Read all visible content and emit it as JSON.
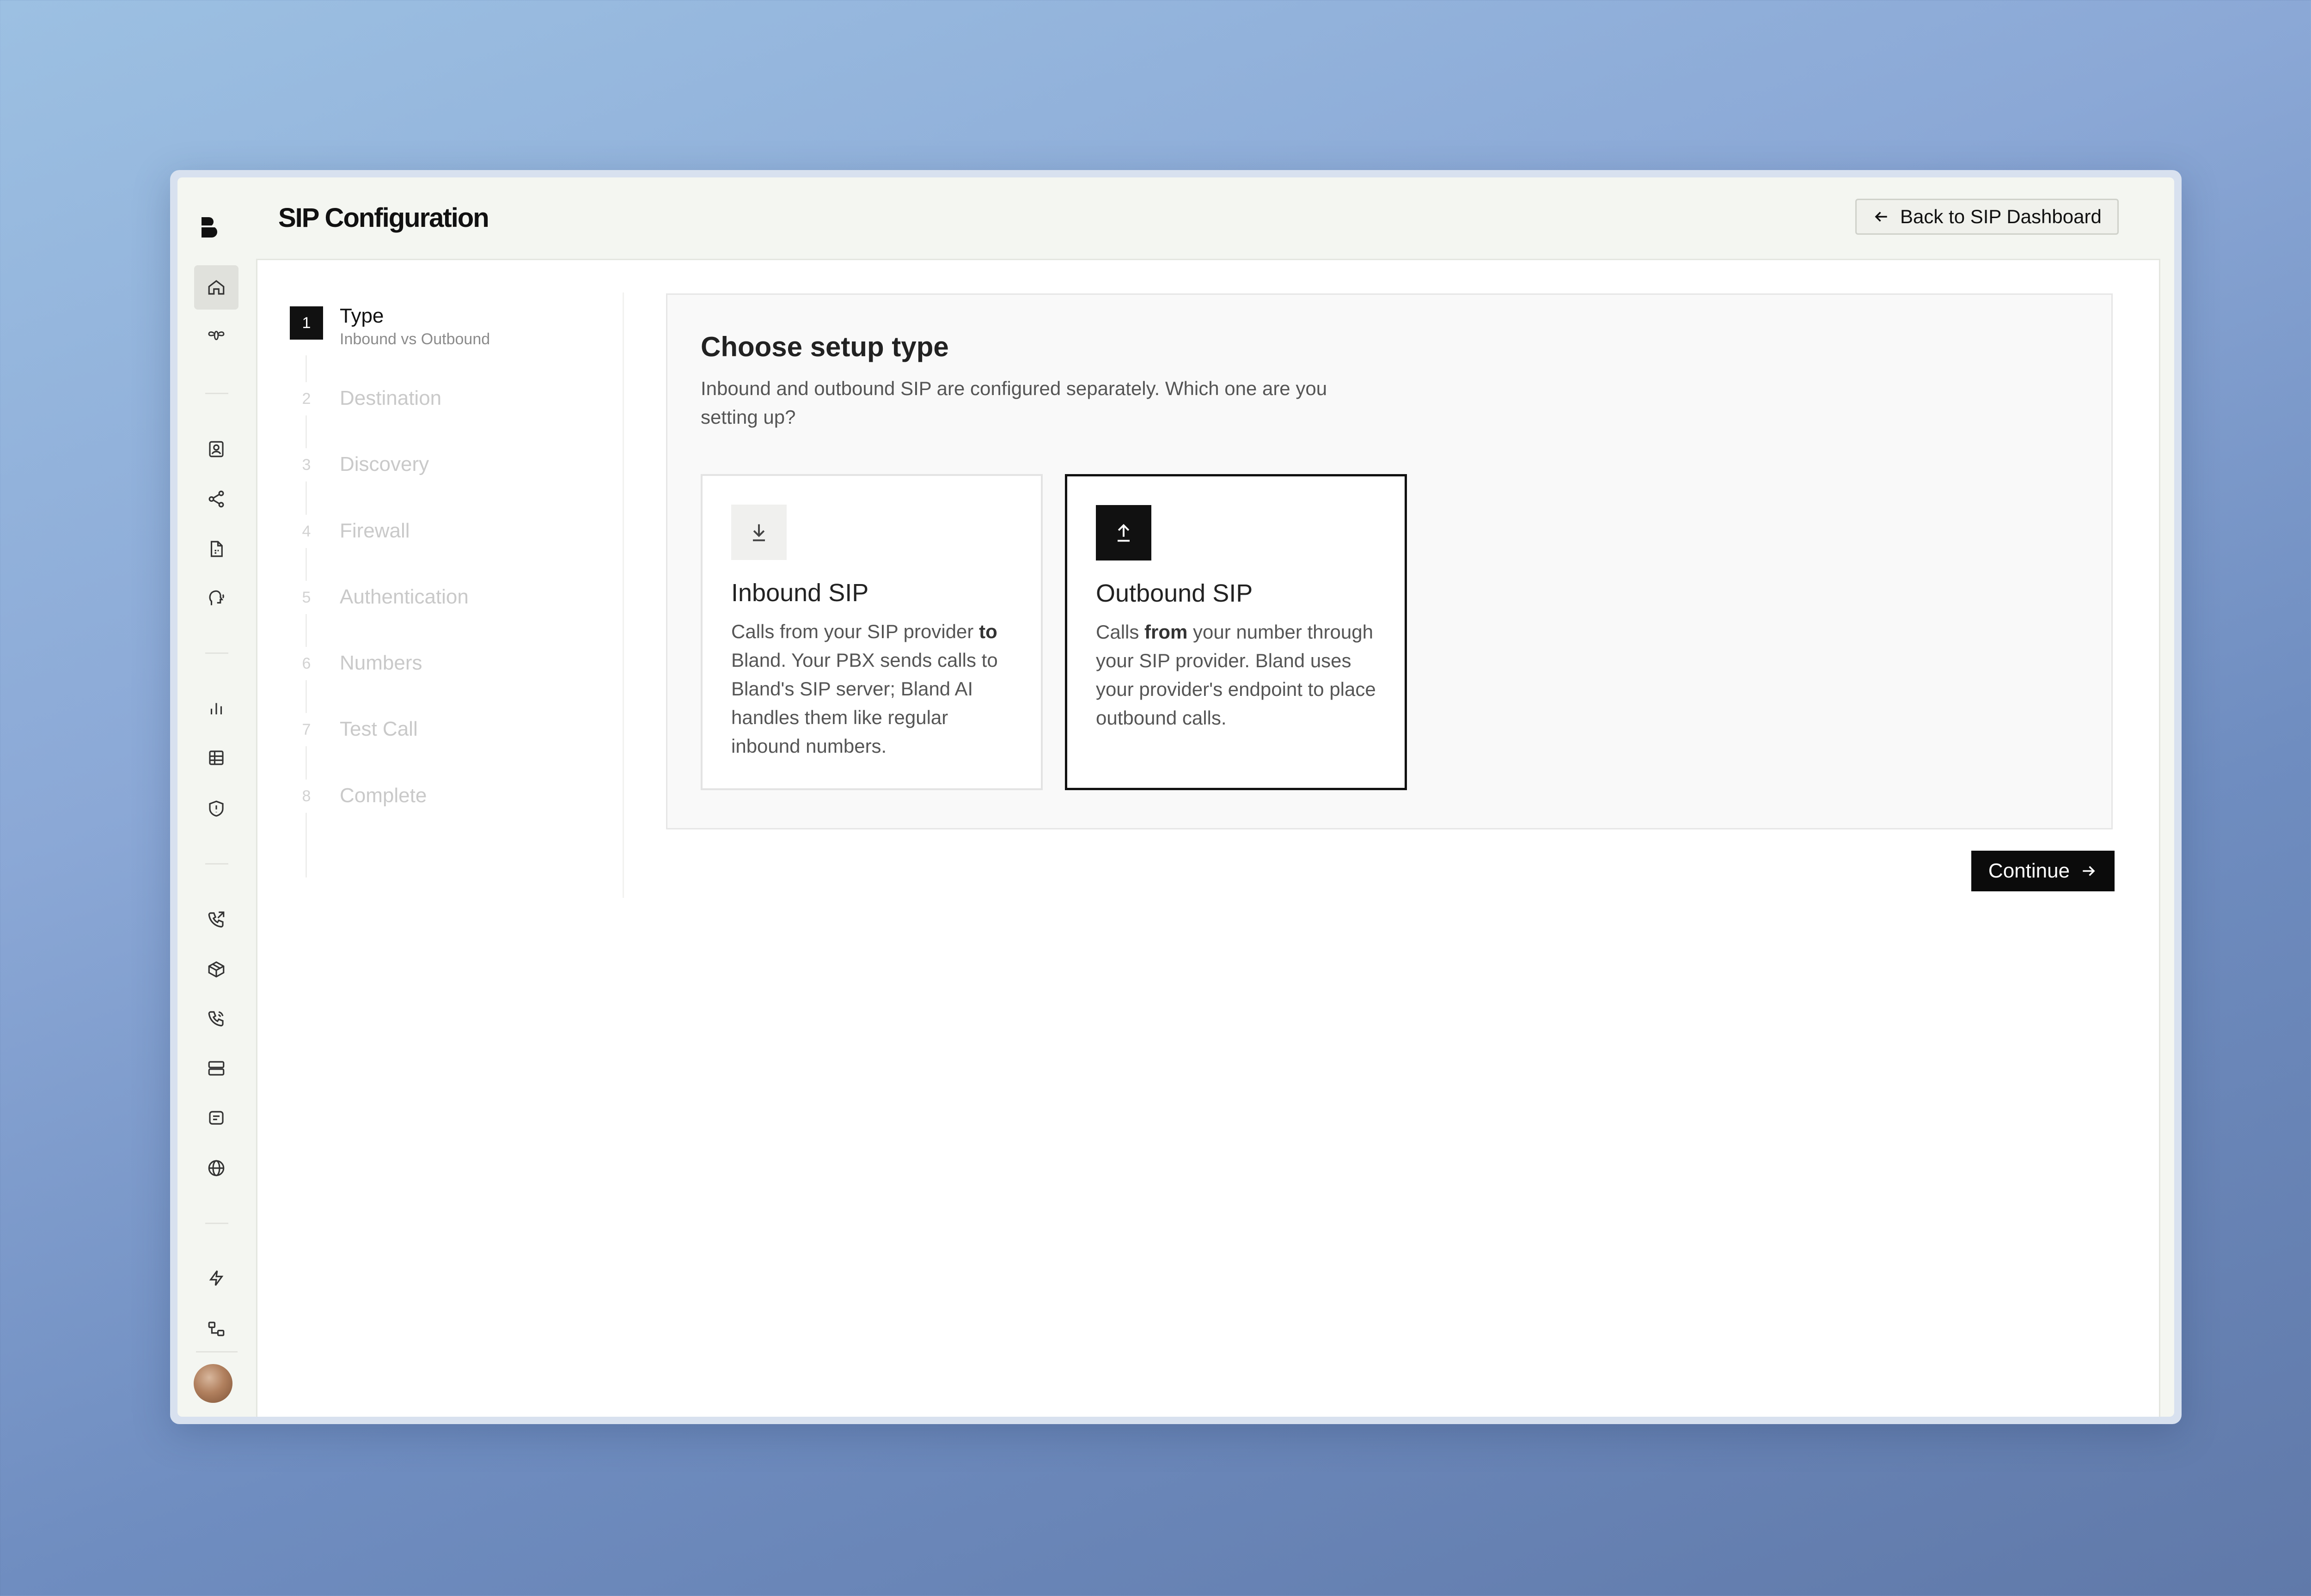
{
  "header": {
    "title": "SIP Configuration",
    "back_label": "Back to SIP Dashboard"
  },
  "steps": [
    {
      "number": "1",
      "label": "Type",
      "sublabel": "Inbound vs Outbound"
    },
    {
      "number": "2",
      "label": "Destination"
    },
    {
      "number": "3",
      "label": "Discovery"
    },
    {
      "number": "4",
      "label": "Firewall"
    },
    {
      "number": "5",
      "label": "Authentication"
    },
    {
      "number": "6",
      "label": "Numbers"
    },
    {
      "number": "7",
      "label": "Test Call"
    },
    {
      "number": "8",
      "label": "Complete"
    }
  ],
  "setup": {
    "title": "Choose setup type",
    "description": "Inbound and outbound SIP are configured separately. Which one are you setting up?",
    "options": [
      {
        "title": "Inbound SIP",
        "desc_before": "Calls from your SIP provider ",
        "desc_bold": "to",
        "desc_after": " Bland. Your PBX sends calls to Bland's SIP server; Bland AI handles them like regular inbound numbers.",
        "icon": "download-icon"
      },
      {
        "title": "Outbound SIP",
        "desc_before": "Calls ",
        "desc_bold": "from",
        "desc_after": " your number through your SIP provider. Bland uses your provider's endpoint to place outbound calls.",
        "icon": "upload-icon"
      }
    ],
    "selected": "Outbound SIP"
  },
  "actions": {
    "continue_label": "Continue"
  },
  "sidebar": {
    "icons": [
      "home-icon",
      "bee-icon",
      "contact-icon",
      "share-icon",
      "file-icon",
      "voice-icon",
      "analytics-icon",
      "table-icon",
      "shield-icon",
      "phone-outgoing-icon",
      "package-icon",
      "phone-icon",
      "server-icon",
      "message-icon",
      "globe-icon",
      "bolt-icon",
      "integrations-icon"
    ]
  },
  "colors": {
    "accent": "#111111",
    "sidebar_active": "#e0e1dc",
    "app_background": "#f4f6f1"
  }
}
